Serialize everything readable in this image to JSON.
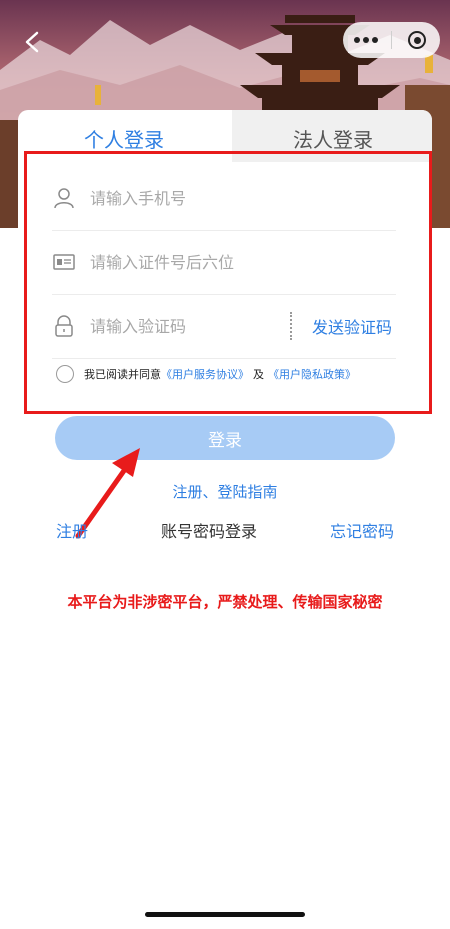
{
  "nav": {
    "back_icon": "chevron-left-icon",
    "more_icon": "more-dots-icon",
    "close_icon": "target-icon"
  },
  "tabs": [
    {
      "label": "个人登录",
      "active": true
    },
    {
      "label": "法人登录",
      "active": false
    }
  ],
  "form": {
    "phone_placeholder": "请输入手机号",
    "id_placeholder": "请输入证件号后六位",
    "code_placeholder": "请输入验证码",
    "send_code_label": "发送验证码"
  },
  "agreement": {
    "prefix": "我已阅读并同意",
    "service_link": "《用户服务协议》",
    "joiner": "及",
    "privacy_link": "《用户隐私政策》"
  },
  "login_button": "登录",
  "guide_link": "注册、登陆指南",
  "bottom": {
    "register": "注册",
    "password_login": "账号密码登录",
    "forgot_password": "忘记密码"
  },
  "warning_text": "本平台为非涉密平台，严禁处理、传输国家秘密",
  "colors": {
    "accent": "#2f7fe2",
    "button_disabled": "#a7cbf5",
    "annotation_red": "#e81b1b"
  }
}
